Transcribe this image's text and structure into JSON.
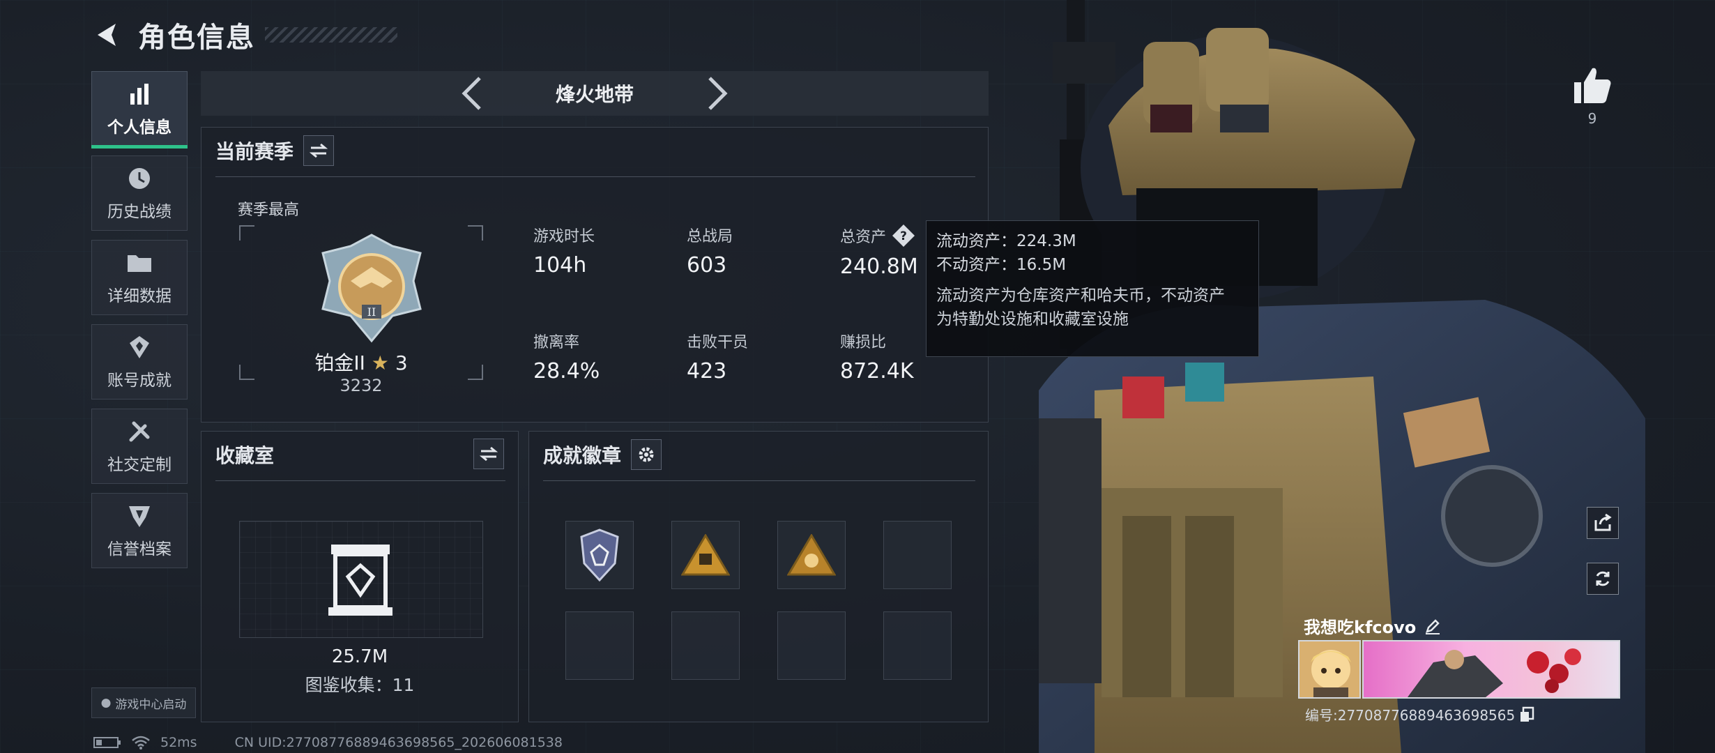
{
  "header": {
    "title": "角色信息"
  },
  "nav": {
    "items": [
      {
        "label": "个人信息",
        "icon": "bar-chart-icon",
        "active": true
      },
      {
        "label": "历史战绩",
        "icon": "history-icon"
      },
      {
        "label": "详细数据",
        "icon": "folder-icon"
      },
      {
        "label": "账号成就",
        "icon": "achievement-icon"
      },
      {
        "label": "社交定制",
        "icon": "wrench-icon"
      },
      {
        "label": "信誉档案",
        "icon": "shield-icon"
      }
    ]
  },
  "launch_badge": "游戏中心启动",
  "mode_bar": {
    "mode": "烽火地带"
  },
  "season": {
    "title": "当前赛季",
    "season_high": "赛季最高",
    "rank_name": "铂金II",
    "rank_stars": "3",
    "rank_points": "3232",
    "stats": [
      {
        "label": "游戏时长",
        "value": "104h"
      },
      {
        "label": "总战局",
        "value": "603"
      },
      {
        "label": "总资产",
        "value": "240.8M",
        "has_help": true
      },
      {
        "label": "撤离率",
        "value": "28.4%"
      },
      {
        "label": "击败干员",
        "value": "423"
      },
      {
        "label": "赚损比",
        "value": "872.4K"
      }
    ]
  },
  "tooltip": {
    "liquid": "流动资产：224.3M",
    "fixed": "不动资产：16.5M",
    "desc1": "流动资产为仓库资产和哈夫币，不动资产",
    "desc2": "为特勤处设施和收藏室设施"
  },
  "vault": {
    "title": "收藏室",
    "value": "25.7M",
    "collection": "图鉴收集：11"
  },
  "badges": {
    "title": "成就徽章",
    "filled": 3,
    "total": 8
  },
  "profile": {
    "likes": "9",
    "name": "我想吃kfcovo",
    "id": "编号:2770877688946369856​5"
  },
  "status": {
    "ping": "52ms",
    "uid": "CN UID:27708776889463698565_202606081538"
  },
  "colors": {
    "accent": "#2ec28a",
    "panel_border": "#3b424d",
    "background": "#1b2028"
  }
}
